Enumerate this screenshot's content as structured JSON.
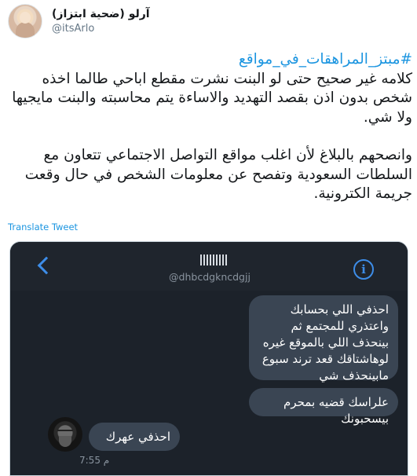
{
  "author": {
    "display_name": "آرلو (ضحية ابتزاز)",
    "handle": "@itsArlo"
  },
  "tweet": {
    "hashtag": "#مبتز_المراهقات_في_مواقع",
    "paragraph1": "كلامه غير صحيح حتى لو البنت نشرت مقطع اباحي طالما اخذه شخص بدون اذن بقصد التهديد والاساءة يتم محاسبته والبنت مايجيها ولا شي.",
    "paragraph2": "وانصحهم بالبلاغ لأن اغلب مواقع التواصل الاجتماعي تتعاون مع السلطات السعودية وتفصح عن معلومات الشخص في حال وقعت جريمة الكترونية.",
    "translate_label": "Translate Tweet"
  },
  "chat": {
    "contact_handle": "@dhbcdgkncdgjj",
    "messages": [
      {
        "text": "احذفي اللي بحسابك واعتذري للمجتمع ثم بينحذف اللي بالموقع غيره لوهاشتاقك قعد ترند سبوع مابينحذف شي"
      },
      {
        "text": "علراسك قضيه بمحرم بيسحبونك"
      },
      {
        "text": "احذفي عهرك"
      }
    ],
    "timestamp": "7:55 م"
  },
  "icons": {
    "back": "chevron-left-icon",
    "info": "info-icon"
  },
  "colors": {
    "link": "#1b95e0",
    "chat_bg": "#1c222a",
    "bubble": "#3a4553",
    "accent": "#3d8de8"
  }
}
